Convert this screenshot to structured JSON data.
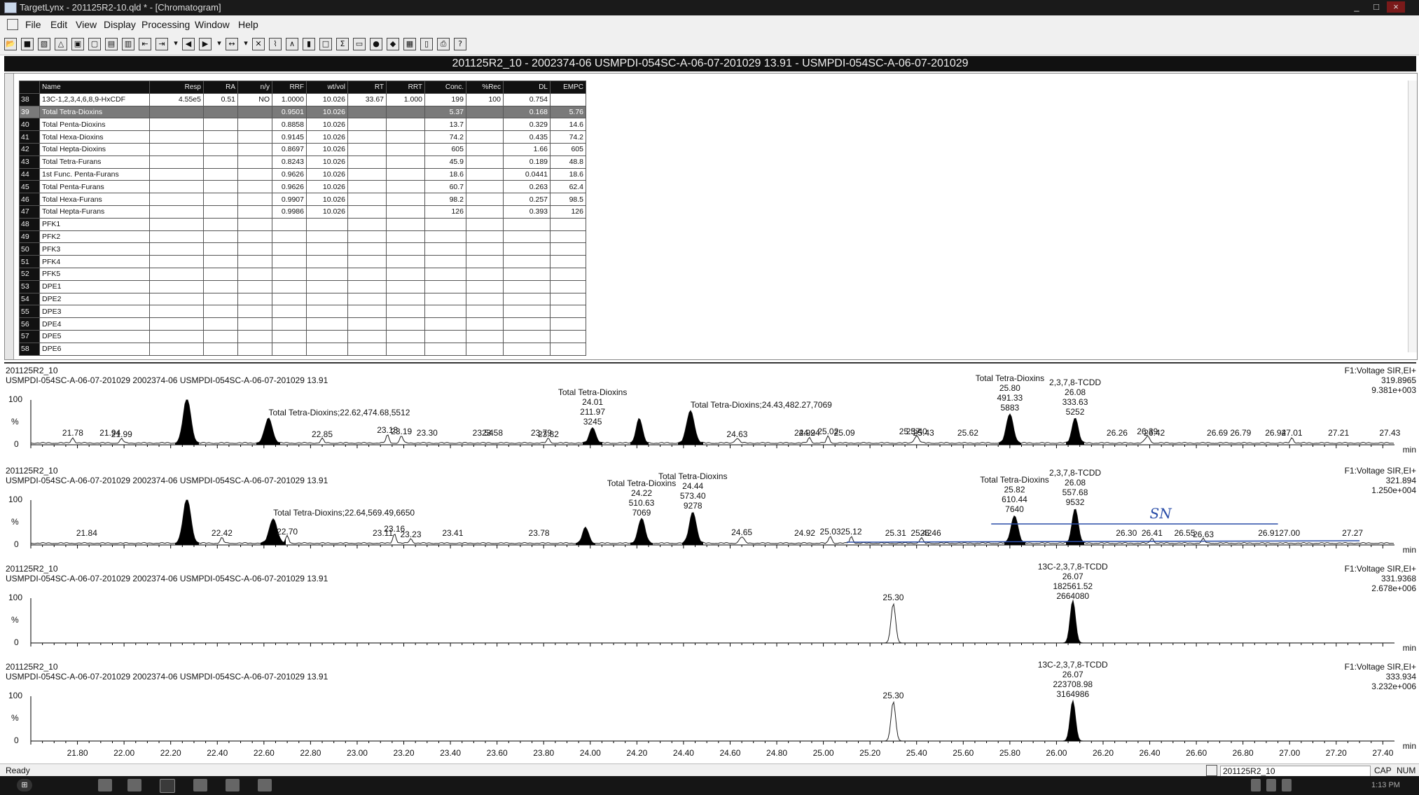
{
  "titlebar": {
    "title": "TargetLynx - 201125R2-10.qld * - [Chromatogram]",
    "minimize": "_",
    "restore": "□",
    "close": "×"
  },
  "menu": [
    "File",
    "Edit",
    "View",
    "Display",
    "Processing",
    "Window",
    "Help"
  ],
  "toolbar_icons": [
    "open-icon",
    "save-icon",
    "print-preview-icon",
    "scale-icon",
    "report-icon",
    "report-2-icon",
    "chart-icon",
    "chart-2-icon",
    "first-icon",
    "next-icon",
    "dropdown-icon",
    "back-icon",
    "forward-icon",
    "dropdown-icon",
    "range-icon",
    "dropdown-icon",
    "cross-icon",
    "integrate-icon",
    "peak-icon",
    "bar-icon",
    "box-icon",
    "sigma-icon",
    "book-icon",
    "circle-icon",
    "cube-icon",
    "grid-icon",
    "columns-icon",
    "printer-icon",
    "help-icon"
  ],
  "sample_header": "201125R2_10 - 2002374-06 USMPDI-054SC-A-06-07-201029 13.91 - USMPDI-054SC-A-06-07-201029",
  "table": {
    "columns": [
      "",
      "Name",
      "Resp",
      "RA",
      "n/y",
      "RRF",
      "wt/vol",
      "RT",
      "RRT",
      "Conc.",
      "%Rec",
      "DL",
      "EMPC"
    ],
    "rows": [
      [
        "38",
        "13C-1,2,3,4,6,8,9-HxCDF",
        "4.55e5",
        "0.51",
        "NO",
        "1.0000",
        "10.026",
        "33.67",
        "1.000",
        "199",
        "100",
        "0.754",
        ""
      ],
      [
        "39",
        "Total Tetra-Dioxins",
        "",
        "",
        "",
        "0.9501",
        "10.026",
        "",
        "",
        "5.37",
        "",
        "0.168",
        "5.76"
      ],
      [
        "40",
        "Total Penta-Dioxins",
        "",
        "",
        "",
        "0.8858",
        "10.026",
        "",
        "",
        "13.7",
        "",
        "0.329",
        "14.6"
      ],
      [
        "41",
        "Total Hexa-Dioxins",
        "",
        "",
        "",
        "0.9145",
        "10.026",
        "",
        "",
        "74.2",
        "",
        "0.435",
        "74.2"
      ],
      [
        "42",
        "Total Hepta-Dioxins",
        "",
        "",
        "",
        "0.8697",
        "10.026",
        "",
        "",
        "605",
        "",
        "1.66",
        "605"
      ],
      [
        "43",
        "Total Tetra-Furans",
        "",
        "",
        "",
        "0.8243",
        "10.026",
        "",
        "",
        "45.9",
        "",
        "0.189",
        "48.8"
      ],
      [
        "44",
        "1st Func. Penta-Furans",
        "",
        "",
        "",
        "0.9626",
        "10.026",
        "",
        "",
        "18.6",
        "",
        "0.0441",
        "18.6"
      ],
      [
        "45",
        "Total Penta-Furans",
        "",
        "",
        "",
        "0.9626",
        "10.026",
        "",
        "",
        "60.7",
        "",
        "0.263",
        "62.4"
      ],
      [
        "46",
        "Total Hexa-Furans",
        "",
        "",
        "",
        "0.9907",
        "10.026",
        "",
        "",
        "98.2",
        "",
        "0.257",
        "98.5"
      ],
      [
        "47",
        "Total Hepta-Furans",
        "",
        "",
        "",
        "0.9986",
        "10.026",
        "",
        "",
        "126",
        "",
        "0.393",
        "126"
      ],
      [
        "48",
        "PFK1",
        "",
        "",
        "",
        "",
        "",
        "",
        "",
        "",
        "",
        "",
        ""
      ],
      [
        "49",
        "PFK2",
        "",
        "",
        "",
        "",
        "",
        "",
        "",
        "",
        "",
        "",
        ""
      ],
      [
        "50",
        "PFK3",
        "",
        "",
        "",
        "",
        "",
        "",
        "",
        "",
        "",
        "",
        ""
      ],
      [
        "51",
        "PFK4",
        "",
        "",
        "",
        "",
        "",
        "",
        "",
        "",
        "",
        "",
        ""
      ],
      [
        "52",
        "PFK5",
        "",
        "",
        "",
        "",
        "",
        "",
        "",
        "",
        "",
        "",
        ""
      ],
      [
        "53",
        "DPE1",
        "",
        "",
        "",
        "",
        "",
        "",
        "",
        "",
        "",
        "",
        ""
      ],
      [
        "54",
        "DPE2",
        "",
        "",
        "",
        "",
        "",
        "",
        "",
        "",
        "",
        "",
        ""
      ],
      [
        "55",
        "DPE3",
        "",
        "",
        "",
        "",
        "",
        "",
        "",
        "",
        "",
        "",
        ""
      ],
      [
        "56",
        "DPE4",
        "",
        "",
        "",
        "",
        "",
        "",
        "",
        "",
        "",
        "",
        ""
      ],
      [
        "57",
        "DPE5",
        "",
        "",
        "",
        "",
        "",
        "",
        "",
        "",
        "",
        "",
        ""
      ],
      [
        "58",
        "DPE6",
        "",
        "",
        "",
        "",
        "",
        "",
        "",
        "",
        "",
        "",
        ""
      ]
    ],
    "selected_row": "39"
  },
  "chromatograms": [
    {
      "line1": "201125R2_10",
      "line2": "USMPDI-054SC-A-06-07-201029 2002374-06 USMPDI-054SC-A-06-07-201029 13.91",
      "func": "F1:Voltage SIR,EI+",
      "mass": "319.8965",
      "intensity": "9.381e+003",
      "annotations": [
        {
          "rt": 21.78,
          "text": "21.78"
        },
        {
          "rt": 21.94,
          "text": "21.94"
        },
        {
          "rt": 21.99,
          "text": "21.99"
        },
        {
          "rt": 22.62,
          "text": "Total Tetra-Dioxins;22.62,474.68,5512"
        },
        {
          "rt": 22.85,
          "text": "22.85"
        },
        {
          "rt": 23.13,
          "text": "23.13"
        },
        {
          "rt": 23.19,
          "text": "23.19"
        },
        {
          "rt": 23.3,
          "text": "23.30"
        },
        {
          "rt": 23.54,
          "text": "23.54"
        },
        {
          "rt": 23.58,
          "text": "23.58"
        },
        {
          "rt": 23.79,
          "text": "23.79"
        },
        {
          "rt": 23.82,
          "text": "23.82"
        },
        {
          "rt": 24.01,
          "text": "Total Tetra-Dioxins\n24.01\n211.97\n3245"
        },
        {
          "rt": 24.43,
          "text": "Total Tetra-Dioxins;24.43,482.27,7069"
        },
        {
          "rt": 24.63,
          "text": "24.63"
        },
        {
          "rt": 24.92,
          "text": "24.92"
        },
        {
          "rt": 24.94,
          "text": "24.94"
        },
        {
          "rt": 25.02,
          "text": "25.02"
        },
        {
          "rt": 25.09,
          "text": "25.09"
        },
        {
          "rt": 25.37,
          "text": "25.37"
        },
        {
          "rt": 25.4,
          "text": "25.40"
        },
        {
          "rt": 25.43,
          "text": "25.43"
        },
        {
          "rt": 25.8,
          "text": "Total Tetra-Dioxins\n25.80\n491.33\n5883"
        },
        {
          "rt": 25.62,
          "text": "25.62"
        },
        {
          "rt": 26.08,
          "text": "2,3,7,8-TCDD\n26.08\n333.63\n5252"
        },
        {
          "rt": 26.26,
          "text": "26.26"
        },
        {
          "rt": 26.39,
          "text": "26.39"
        },
        {
          "rt": 26.42,
          "text": "26.42"
        },
        {
          "rt": 26.69,
          "text": "26.69"
        },
        {
          "rt": 26.79,
          "text": "26.79"
        },
        {
          "rt": 26.94,
          "text": "26.94"
        },
        {
          "rt": 27.01,
          "text": "27.01"
        },
        {
          "rt": 27.21,
          "text": "27.21"
        },
        {
          "rt": 27.43,
          "text": "27.43"
        }
      ]
    },
    {
      "line1": "201125R2_10",
      "line2": "USMPDI-054SC-A-06-07-201029 2002374-06 USMPDI-054SC-A-06-07-201029 13.91",
      "func": "F1:Voltage SIR,EI+",
      "mass": "321.894",
      "intensity": "1.250e+004",
      "annotations": [
        {
          "rt": 21.84,
          "text": "21.84"
        },
        {
          "rt": 22.42,
          "text": "22.42"
        },
        {
          "rt": 22.64,
          "text": "Total Tetra-Dioxins;22.64,569.49,6650"
        },
        {
          "rt": 22.7,
          "text": "22.70"
        },
        {
          "rt": 23.11,
          "text": "23.11"
        },
        {
          "rt": 23.16,
          "text": "23.16"
        },
        {
          "rt": 23.23,
          "text": "23.23"
        },
        {
          "rt": 23.41,
          "text": "23.41"
        },
        {
          "rt": 23.78,
          "text": "23.78"
        },
        {
          "rt": 24.22,
          "text": "Total Tetra-Dioxins\n24.22\n510.63\n7069"
        },
        {
          "rt": 24.44,
          "text": "Total Tetra-Dioxins\n24.44\n573.40\n9278"
        },
        {
          "rt": 24.65,
          "text": "24.65"
        },
        {
          "rt": 24.92,
          "text": "24.92"
        },
        {
          "rt": 25.03,
          "text": "25.03"
        },
        {
          "rt": 25.12,
          "text": "25.12"
        },
        {
          "rt": 25.31,
          "text": "25.31"
        },
        {
          "rt": 25.42,
          "text": "25.42"
        },
        {
          "rt": 25.46,
          "text": "25.46"
        },
        {
          "rt": 25.82,
          "text": "Total Tetra-Dioxins\n25.82\n610.44\n7640"
        },
        {
          "rt": 26.08,
          "text": "2,3,7,8-TCDD\n26.08\n557.68\n9532"
        },
        {
          "rt": 26.3,
          "text": "26.30"
        },
        {
          "rt": 26.41,
          "text": "26.41"
        },
        {
          "rt": 26.55,
          "text": "26.55"
        },
        {
          "rt": 26.63,
          "text": "26.63"
        },
        {
          "rt": 26.91,
          "text": "26.91"
        },
        {
          "rt": 27.0,
          "text": "27.00"
        },
        {
          "rt": 27.27,
          "text": "27.27"
        }
      ],
      "handwritten": "SN"
    },
    {
      "line1": "201125R2_10",
      "line2": "USMPDI-054SC-A-06-07-201029 2002374-06 USMPDI-054SC-A-06-07-201029 13.91",
      "func": "F1:Voltage SIR,EI+",
      "mass": "331.9368",
      "intensity": "2.678e+006",
      "annotations": [
        {
          "rt": 25.3,
          "text": "25.30"
        },
        {
          "rt": 26.07,
          "text": "13C-2,3,7,8-TCDD\n26.07\n182561.52\n2664080"
        }
      ]
    },
    {
      "line1": "201125R2_10",
      "line2": "USMPDI-054SC-A-06-07-201029 2002374-06 USMPDI-054SC-A-06-07-201029 13.91",
      "func": "F1:Voltage SIR,EI+",
      "mass": "333.934",
      "intensity": "3.232e+006",
      "annotations": [
        {
          "rt": 25.3,
          "text": "25.30"
        },
        {
          "rt": 26.07,
          "text": "13C-2,3,7,8-TCDD\n26.07\n223708.98\n3164986"
        }
      ]
    }
  ],
  "axis": {
    "ylabels": [
      "100",
      "%",
      "0"
    ],
    "x_min_unit": "min",
    "xticks": [
      "21.80",
      "22.00",
      "22.20",
      "22.40",
      "22.60",
      "22.80",
      "23.00",
      "23.20",
      "23.40",
      "23.60",
      "23.80",
      "24.00",
      "24.20",
      "24.40",
      "24.60",
      "24.80",
      "25.00",
      "25.20",
      "25.40",
      "25.60",
      "25.80",
      "26.00",
      "26.20",
      "26.40",
      "26.60",
      "26.80",
      "27.00",
      "27.20",
      "27.40"
    ],
    "x_range": [
      21.6,
      27.45
    ]
  },
  "status": {
    "left": "Ready",
    "file": "201125R2_10",
    "cap": "CAP",
    "num": "NUM"
  },
  "taskbar": {
    "clock": "1:13 PM"
  }
}
